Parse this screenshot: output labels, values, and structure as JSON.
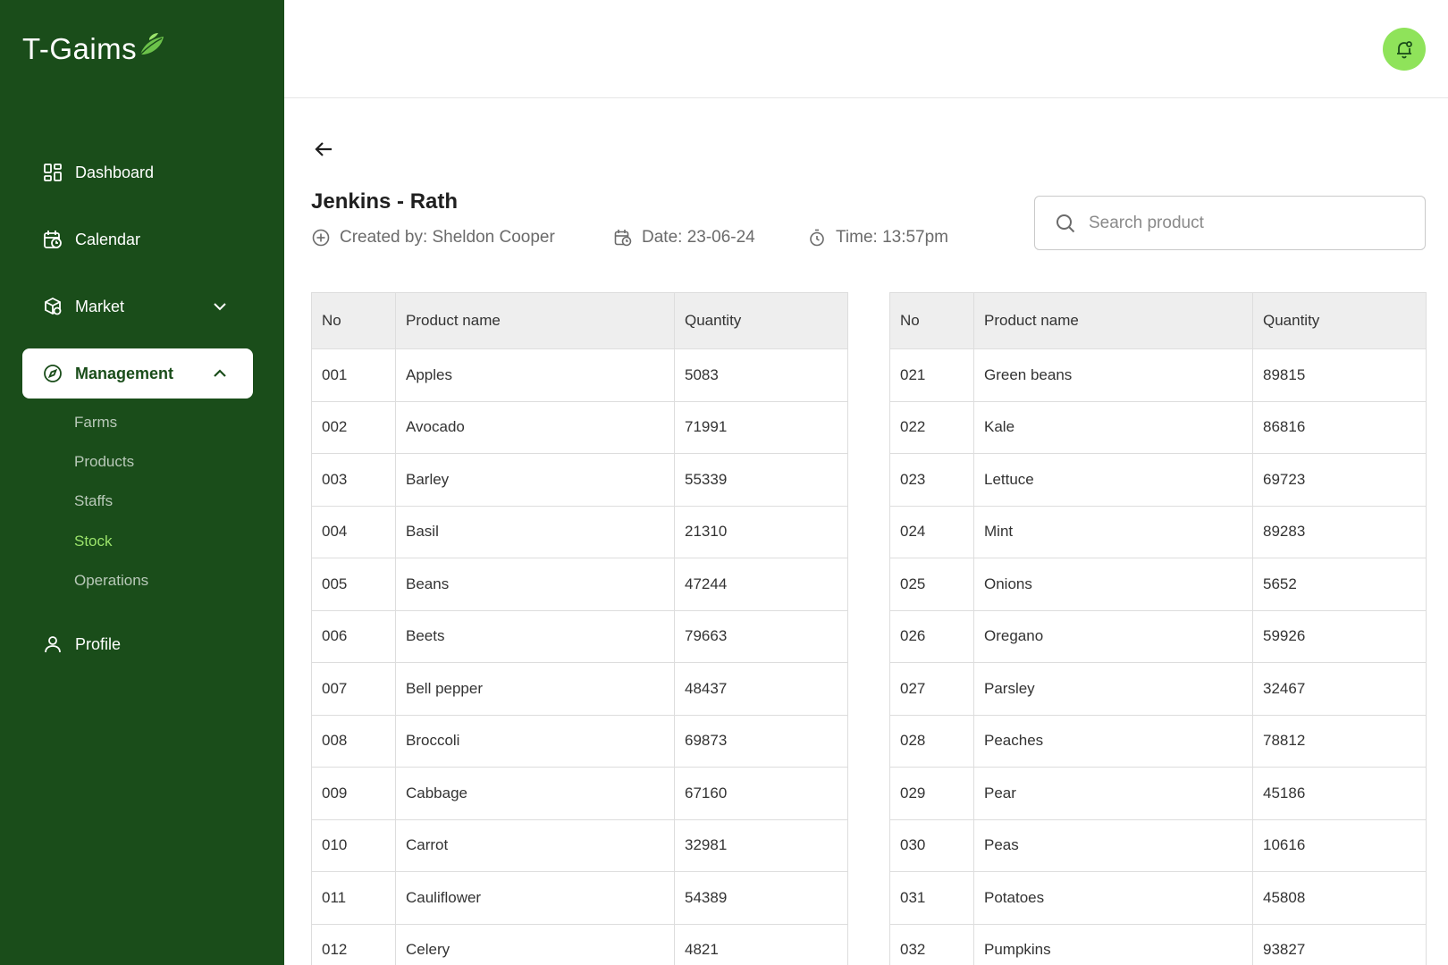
{
  "app": {
    "logo_text": "T-Gaims"
  },
  "sidebar": {
    "items": [
      {
        "label": "Dashboard",
        "icon": "dashboard-icon"
      },
      {
        "label": "Calendar",
        "icon": "calendar-icon"
      },
      {
        "label": "Market",
        "icon": "market-icon"
      },
      {
        "label": "Management",
        "icon": "compass-icon"
      },
      {
        "label": "Profile",
        "icon": "user-icon"
      }
    ],
    "management_sub": [
      "Farms",
      "Products",
      "Staffs",
      "Stock",
      "Operations"
    ],
    "current_sub": "Stock"
  },
  "page": {
    "title": "Jenkins - Rath",
    "created_by": "Created by: Sheldon Cooper",
    "date": "Date: 23-06-24",
    "time": "Time: 13:57pm"
  },
  "search": {
    "placeholder": "Search product"
  },
  "table_headers": [
    "No",
    "Product name",
    "Quantity"
  ],
  "table_left": [
    [
      "001",
      "Apples",
      "5083"
    ],
    [
      "002",
      "Avocado",
      "71991"
    ],
    [
      "003",
      "Barley",
      "55339"
    ],
    [
      "004",
      "Basil",
      "21310"
    ],
    [
      "005",
      "Beans",
      "47244"
    ],
    [
      "006",
      "Beets",
      "79663"
    ],
    [
      "007",
      "Bell pepper",
      "48437"
    ],
    [
      "008",
      "Broccoli",
      "69873"
    ],
    [
      "009",
      "Cabbage",
      "67160"
    ],
    [
      "010",
      "Carrot",
      "32981"
    ],
    [
      "011",
      "Cauliflower",
      "54389"
    ],
    [
      "012",
      "Celery",
      "4821"
    ]
  ],
  "table_right": [
    [
      "021",
      "Green beans",
      "89815"
    ],
    [
      "022",
      "Kale",
      "86816"
    ],
    [
      "023",
      "Lettuce",
      "69723"
    ],
    [
      "024",
      "Mint",
      "89283"
    ],
    [
      "025",
      "Onions",
      "5652"
    ],
    [
      "026",
      "Oregano",
      "59926"
    ],
    [
      "027",
      "Parsley",
      "32467"
    ],
    [
      "028",
      "Peaches",
      "78812"
    ],
    [
      "029",
      "Pear",
      "45186"
    ],
    [
      "030",
      "Peas",
      "10616"
    ],
    [
      "031",
      "Potatoes",
      "45808"
    ],
    [
      "032",
      "Pumpkins",
      "93827"
    ]
  ],
  "colors": {
    "sidebar_bg": "#1a4d1a",
    "accent": "#8fe35a",
    "current_sub": "#9be36b"
  }
}
